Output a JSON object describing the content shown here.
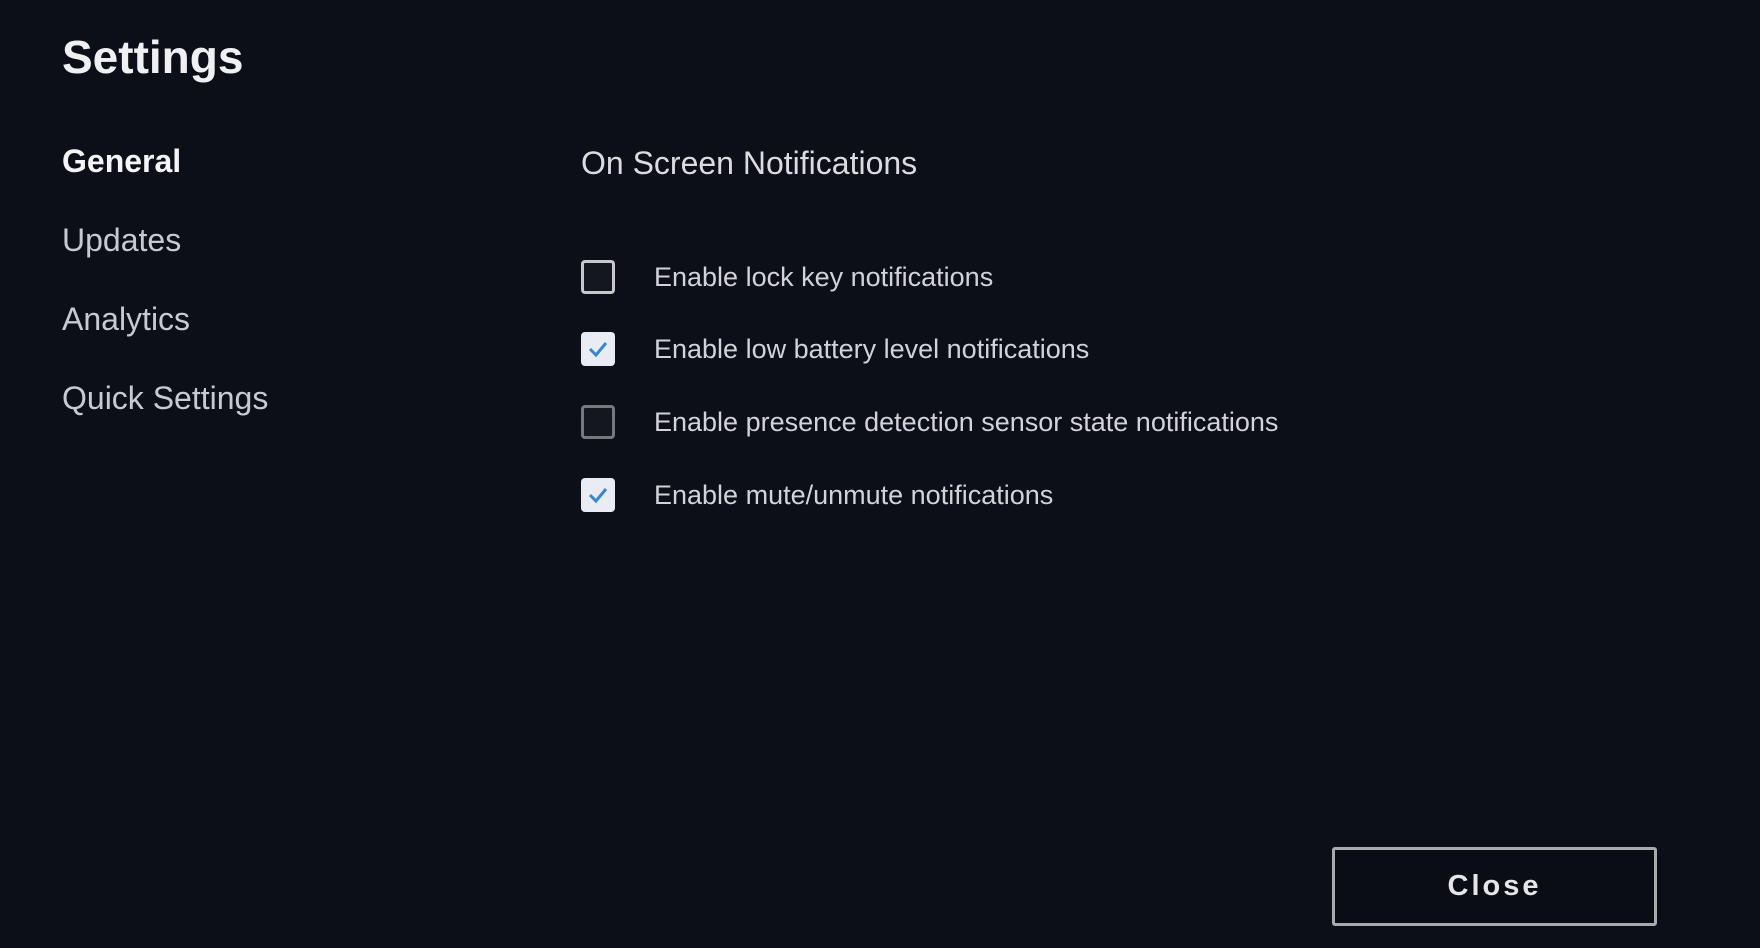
{
  "title": "Settings",
  "nav": {
    "items": [
      {
        "label": "General",
        "active": true
      },
      {
        "label": "Updates",
        "active": false
      },
      {
        "label": "Analytics",
        "active": false
      },
      {
        "label": "Quick Settings",
        "active": false
      }
    ]
  },
  "section": {
    "title": "On Screen Notifications",
    "options": [
      {
        "label": "Enable lock key notifications",
        "checked": false
      },
      {
        "label": "Enable low battery level notifications",
        "checked": true
      },
      {
        "label": "Enable presence detection sensor state notifications",
        "checked": false
      },
      {
        "label": "Enable mute/unmute notifications",
        "checked": true
      }
    ]
  },
  "footer": {
    "close_label": "Close"
  },
  "colors": {
    "background": "#0c0f18",
    "check_accent": "#3a86d6"
  }
}
